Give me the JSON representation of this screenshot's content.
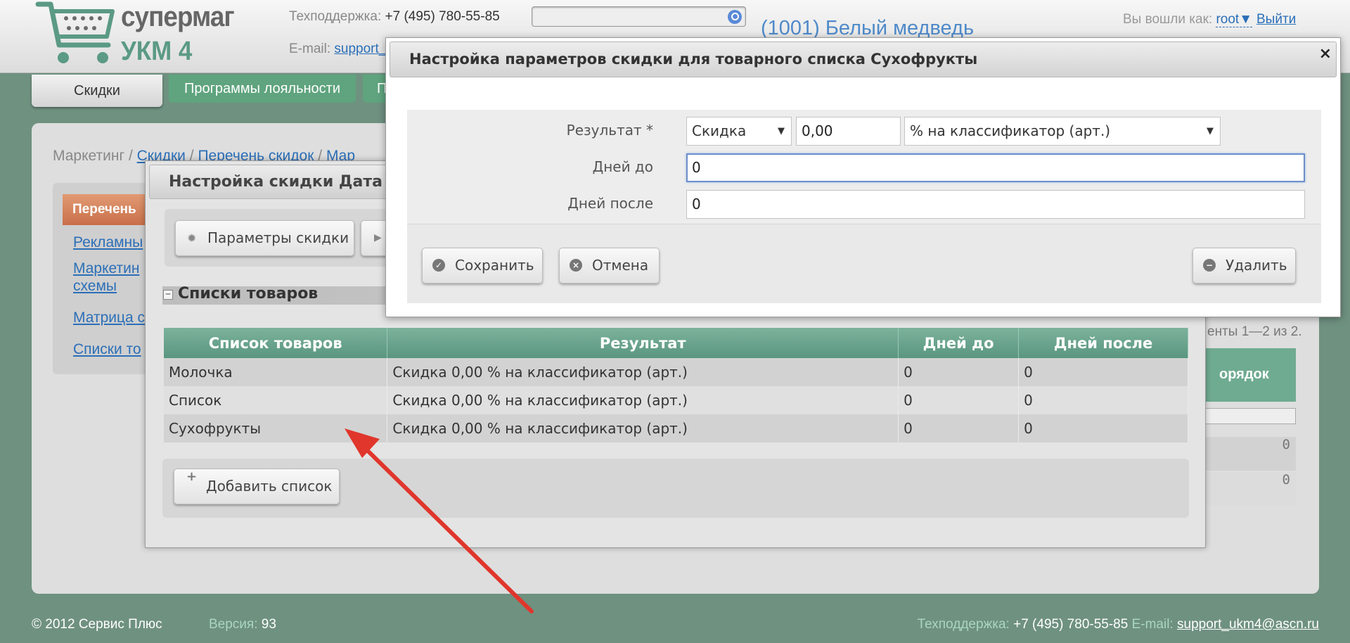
{
  "header": {
    "logo_line1": "супермаг",
    "logo_line2": "УКМ 4",
    "support_label": "Техподдержка:",
    "support_phone": "+7 (495) 780-55-85",
    "email_label": "E-mail:",
    "email_link": "support_",
    "store_name": "(1001) Белый медведь",
    "user_label": "Вы вошли как:",
    "user_name": "root▼",
    "logout": "Выйти"
  },
  "tabs": {
    "active": "Скидки",
    "loyalty": "Программы лояльности",
    "partial": "П"
  },
  "breadcrumb": {
    "root": "Маркетинг",
    "sep": "/",
    "level1": "Скидки",
    "level2": "Перечень скидок",
    "level3": "Мар"
  },
  "sidebar": {
    "header": "Перечень",
    "items": [
      "Рекламны",
      "Маркетин",
      "схемы",
      "Матрица с",
      "Списки то"
    ]
  },
  "background_table": {
    "count_text": "енты 1—2 из 2.",
    "order_header": "орядок",
    "rows": [
      "0",
      "0"
    ]
  },
  "dialog2": {
    "title": "Настройка скидки Дата в",
    "params_button": "Параметры скидки",
    "play_glyph": "▶",
    "section_title": "Списки товаров",
    "columns": [
      "Список товаров",
      "Результат",
      "Дней до",
      "Дней после"
    ],
    "rows": [
      [
        "Молочка",
        "Скидка 0,00 % на классификатор (арт.)",
        "0",
        "0"
      ],
      [
        "Список",
        "Скидка 0,00 % на классификатор (арт.)",
        "0",
        "0"
      ],
      [
        "Сухофрукты",
        "Скидка 0,00 % на классификатор (арт.)",
        "0",
        "0"
      ]
    ],
    "add_button": "Добавить список"
  },
  "dialog1": {
    "title": "Настройка параметров скидки для товарного списка Сухофрукты",
    "close": "×",
    "result_label": "Результат *",
    "result_type": "Скидка",
    "result_value": "0,00",
    "result_unit": "% на классификатор (арт.)",
    "days_before_label": "Дней до",
    "days_before_value": "0",
    "days_after_label": "Дней после",
    "days_after_value": "0",
    "save": "Сохранить",
    "cancel": "Отмена",
    "delete": "Удалить"
  },
  "footer": {
    "copyright": "© 2012 Сервис Плюс",
    "version_label": "Версия:",
    "version_value": "93",
    "support_label": "Техподдержка:",
    "support_phone": "+7 (495) 780-55-85",
    "email_label": "E-mail:",
    "email": "support_ukm4@ascn.ru"
  },
  "colors": {
    "page_bg": "#6f9180",
    "accent_green": "#5fa47e",
    "link_blue": "#2b6fb8",
    "annotation_red": "#e0362c"
  }
}
